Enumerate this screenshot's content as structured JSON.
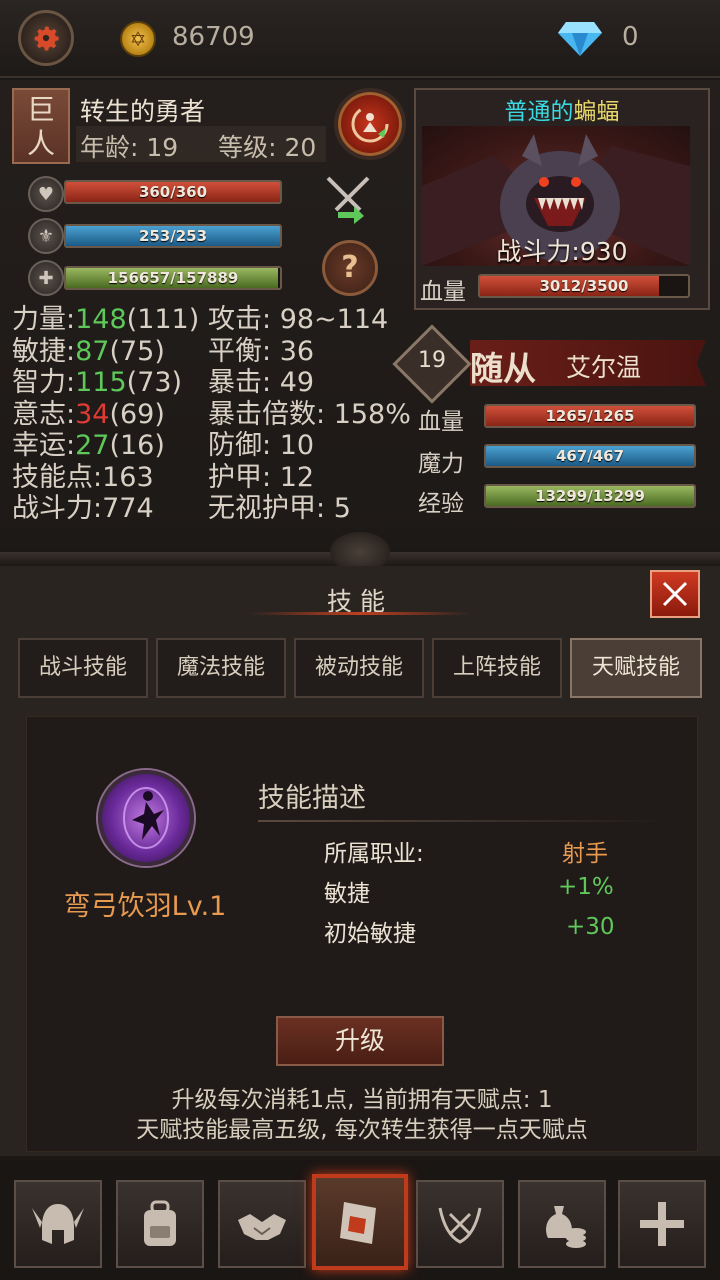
{
  "currency": {
    "gold": "86709",
    "gems": "0"
  },
  "hero": {
    "race": "巨人",
    "name": "转生的勇者",
    "age_label": "年龄:",
    "age": "19",
    "level_label": "等级:",
    "level": "20",
    "hp": "360/360",
    "hp_fraction": 1.0,
    "mp": "253/253",
    "mp_fraction": 1.0,
    "exp": "156657/157889",
    "exp_fraction": 0.992
  },
  "stats_left": [
    {
      "label": "力量:",
      "value": "148",
      "base": "(111)",
      "color": "green"
    },
    {
      "label": "敏捷:",
      "value": "87",
      "base": "(75)",
      "color": "green"
    },
    {
      "label": "智力:",
      "value": "115",
      "base": "(73)",
      "color": "green"
    },
    {
      "label": "意志:",
      "value": "34",
      "base": "(69)",
      "color": "red"
    },
    {
      "label": "幸运:",
      "value": "27",
      "base": "(16)",
      "color": "green"
    },
    {
      "label": "技能点:",
      "value": "163",
      "base": "",
      "color": "plain"
    },
    {
      "label": "战斗力:",
      "value": "774",
      "base": "",
      "color": "plain"
    }
  ],
  "stats_right": [
    {
      "label": "攻击:",
      "value": "98~114"
    },
    {
      "label": "平衡:",
      "value": "36"
    },
    {
      "label": "暴击:",
      "value": "49"
    },
    {
      "label": "暴击倍数:",
      "value": "158%"
    },
    {
      "label": "防御:",
      "value": "10"
    },
    {
      "label": "护甲:",
      "value": "12"
    },
    {
      "label": "无视护甲:",
      "value": "5"
    }
  ],
  "enemy": {
    "quality": "普通的",
    "name": "蝙蝠",
    "power": "战斗力:930",
    "hp_label": "血量",
    "hp": "3012/3500",
    "hp_fraction": 0.861
  },
  "follower": {
    "level": "19",
    "title": "随从",
    "name": "艾尔温",
    "hp_label": "血量",
    "hp": "1265/1265",
    "hp_fraction": 1.0,
    "mp_label": "魔力",
    "mp": "467/467",
    "mp_fraction": 1.0,
    "exp_label": "经验",
    "exp": "13299/13299",
    "exp_fraction": 1.0
  },
  "skill_panel": {
    "title": "技能",
    "tabs": [
      "战斗技能",
      "魔法技能",
      "被动技能",
      "上阵技能",
      "天赋技能"
    ],
    "active_tab": 4,
    "skill_name": "弯弓饮羽Lv.1",
    "desc_title": "技能描述",
    "desc_rows": [
      {
        "key": "所属职业:",
        "value": "射手",
        "color": "#e89a50"
      },
      {
        "key": "敏捷",
        "value": "+1%",
        "color": "#5ec85a"
      },
      {
        "key": "初始敏捷",
        "value": "+30",
        "color": "#5ec85a"
      }
    ],
    "upgrade_label": "升级",
    "note_1": "升级每次消耗1点, 当前拥有天赋点: 1",
    "note_2": "天赋技能最高五级, 每次转生获得一点天赋点"
  },
  "bottom_nav": [
    "helmet-icon",
    "backpack-icon",
    "handshake-icon",
    "skill-book-icon",
    "crossed-swords-icon",
    "money-bag-icon",
    "cross-icon"
  ],
  "bottom_nav_active": 3,
  "colors": {
    "accent_red": "#c03a1c",
    "stat_green": "#5ec85a",
    "stat_red": "#e03a34",
    "enemy_quality": "#3ad8e0",
    "enemy_name": "#e8d86a",
    "skill_orange": "#e89a50"
  }
}
